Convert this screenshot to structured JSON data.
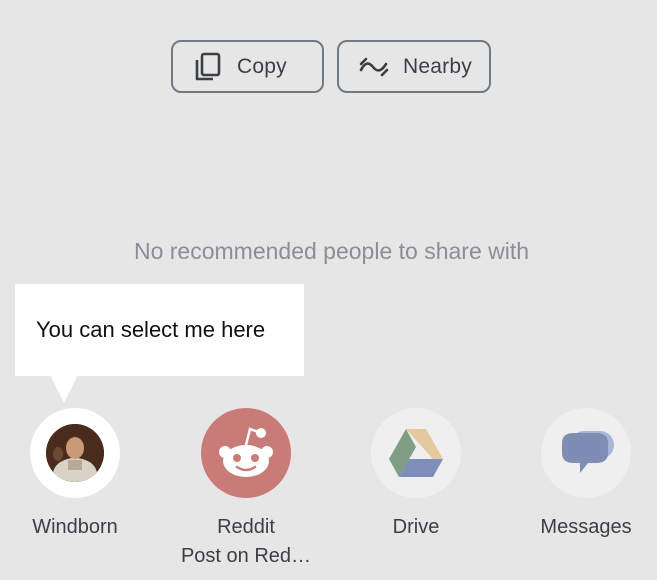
{
  "actions": {
    "copy_label": "Copy",
    "nearby_label": "Nearby"
  },
  "empty_message": "No recommended people to share with",
  "tooltip": {
    "text": "You can select me here"
  },
  "targets": [
    {
      "name": "Windborn",
      "sub": "",
      "icon": "avatar"
    },
    {
      "name": "Reddit",
      "sub": "Post on Red…",
      "icon": "reddit-icon"
    },
    {
      "name": "Drive",
      "sub": "",
      "icon": "drive-icon"
    },
    {
      "name": "Messages",
      "sub": "",
      "icon": "messages-icon"
    }
  ],
  "colors": {
    "background": "#e6e6e6",
    "chip_border": "#6f7a84",
    "reddit_bg": "#c97b78",
    "messages_bubble": "#7f8cb3"
  }
}
